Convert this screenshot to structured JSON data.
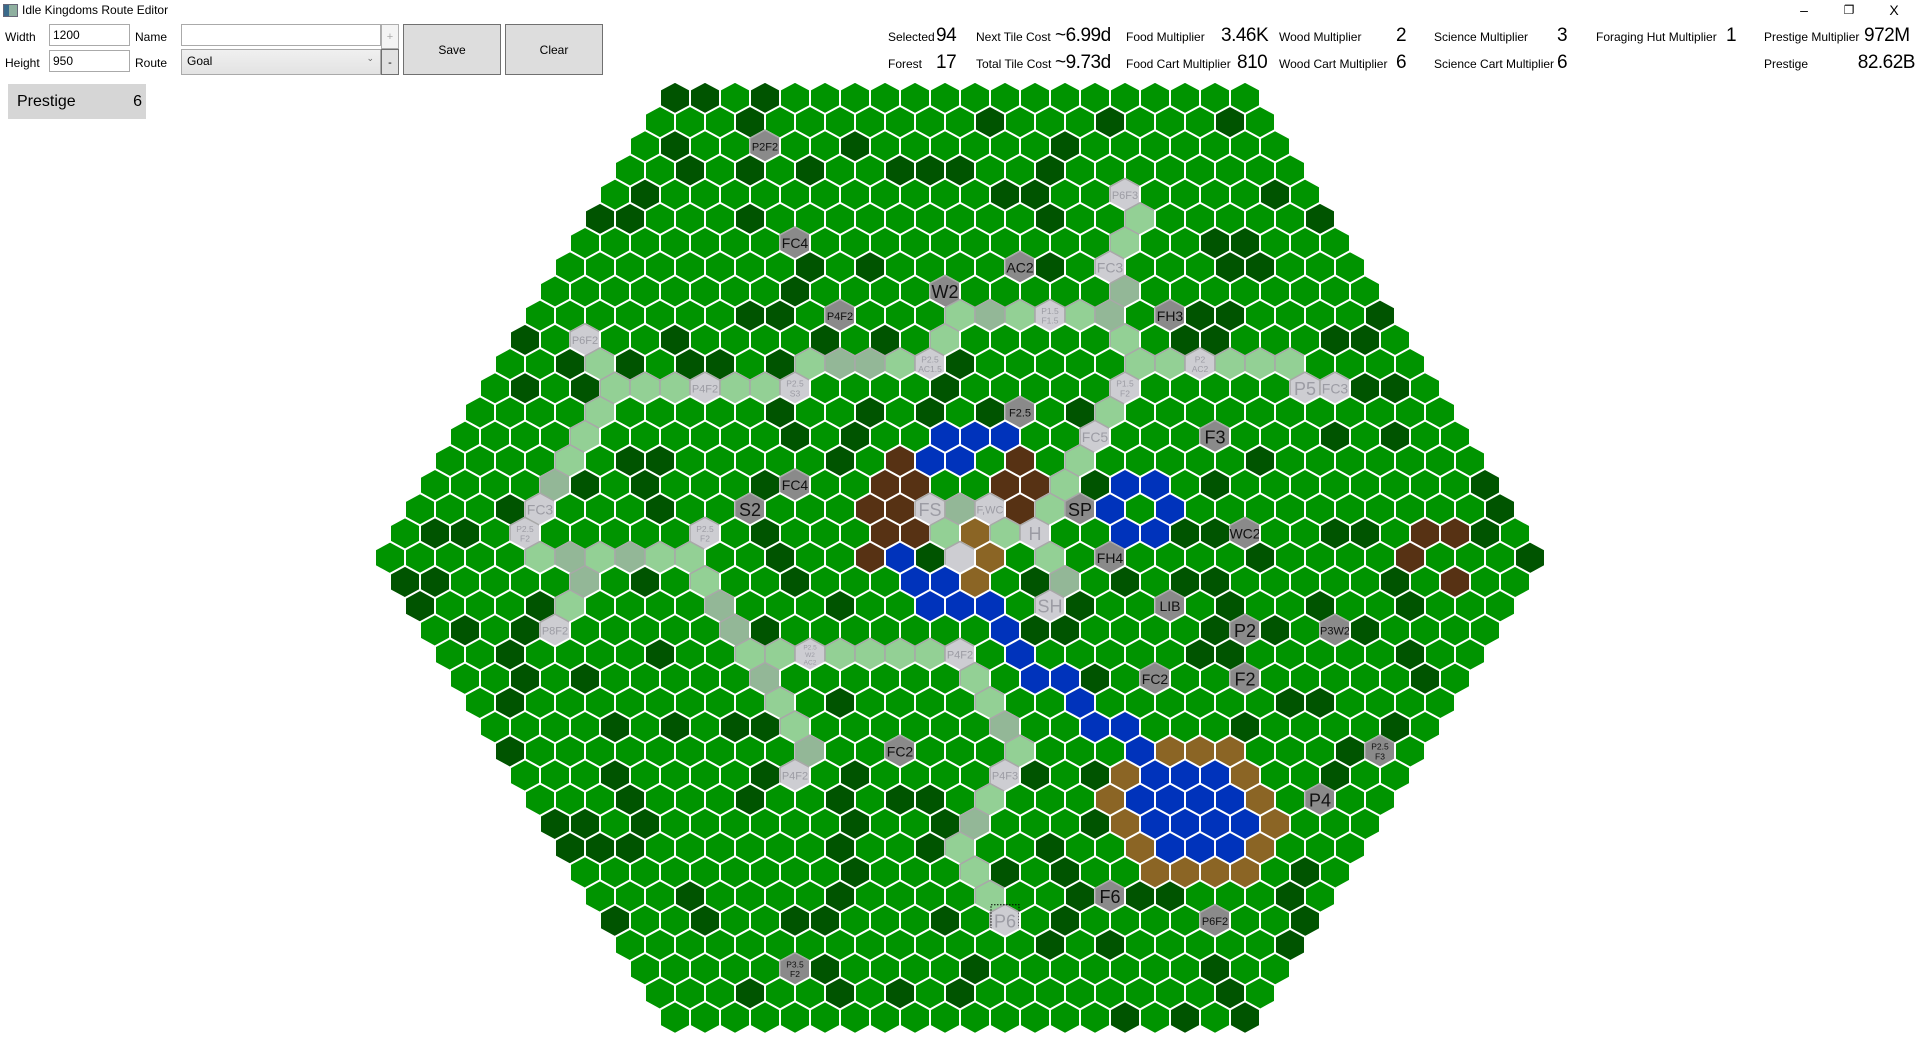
{
  "window": {
    "title": "Idle Kingdoms Route Editor",
    "minimize": "–",
    "restore": "❐",
    "close": "X"
  },
  "toolbar": {
    "width_label": "Width",
    "width_value": "1200",
    "height_label": "Height",
    "height_value": "950",
    "name_label": "Name",
    "name_value": "",
    "add_label": "+",
    "route_label": "Route",
    "route_value": "Goal",
    "remove_label": "-",
    "save_label": "Save",
    "clear_label": "Clear"
  },
  "prestige_box": {
    "label": "Prestige",
    "value": "6"
  },
  "stats": {
    "selected": {
      "label": "Selected",
      "value": "94"
    },
    "forest": {
      "label": "Forest",
      "value": "17"
    },
    "next_tile_cost": {
      "label": "Next Tile Cost",
      "value": "~6.99d"
    },
    "total_tile_cost": {
      "label": "Total Tile Cost",
      "value": "~9.73d"
    },
    "food_multiplier": {
      "label": "Food Multiplier",
      "value": "3.46K"
    },
    "food_cart_multiplier": {
      "label": "Food Cart Multiplier",
      "value": "810"
    },
    "wood_multiplier": {
      "label": "Wood Multiplier",
      "value": "2"
    },
    "wood_cart_multiplier": {
      "label": "Wood Cart Multiplier",
      "value": "6"
    },
    "science_multiplier": {
      "label": "Science Multiplier",
      "value": "3"
    },
    "science_cart_multiplier": {
      "label": "Science Cart Multiplier",
      "value": "6"
    },
    "foraging_hut_multiplier": {
      "label": "Foraging Hut Multiplier",
      "value": "1"
    },
    "prestige_multiplier": {
      "label": "Prestige Multiplier",
      "value": "972M"
    },
    "prestige": {
      "label": "Prestige",
      "value": "82.62B"
    }
  },
  "board": {
    "rows": 39,
    "min_row_length": 20,
    "selected_tile": [
      34,
      13
    ],
    "colors": {
      "grass": "#009400",
      "forest": "#005400",
      "water": "#0033bb",
      "mountain": "#573214",
      "hill": "#8b6525",
      "path": "#93d095",
      "path_alt": "#93b797",
      "owned": "#cdcdd2",
      "building": "#8a8a8a"
    },
    "tiles": [
      [
        2,
        4,
        "building",
        "P2F2"
      ],
      [
        6,
        7,
        "building",
        "FC4"
      ],
      [
        8,
        13,
        "building",
        "W2"
      ],
      [
        9,
        10,
        "building",
        "P4F2"
      ],
      [
        7,
        15,
        "building",
        "AC2"
      ],
      [
        9,
        21,
        "building",
        "FH3"
      ],
      [
        13,
        18,
        "building",
        "F2.5"
      ],
      [
        14,
        25,
        "building",
        "F3"
      ],
      [
        17,
        22,
        "building",
        "SP"
      ],
      [
        16,
        12,
        "building",
        "FC4"
      ],
      [
        17,
        11,
        "building",
        "S2"
      ],
      [
        18,
        28,
        "building",
        "WC2"
      ],
      [
        19,
        24,
        "building",
        "FH4"
      ],
      [
        21,
        25,
        "building",
        "LIB"
      ],
      [
        22,
        27,
        "building",
        "P2"
      ],
      [
        22,
        30,
        "building",
        "P3W2"
      ],
      [
        24,
        23,
        "building",
        "FC2"
      ],
      [
        24,
        26,
        "building",
        "F2"
      ],
      [
        27,
        13,
        "building",
        "FC2"
      ],
      [
        27,
        29,
        "building",
        "P2.5\nF3"
      ],
      [
        29,
        26,
        "building",
        "P4"
      ],
      [
        33,
        17,
        "building",
        "F6"
      ],
      [
        34,
        20,
        "building",
        "P6F2"
      ],
      [
        36,
        5,
        "building",
        "P3.5\nF2"
      ],
      [
        4,
        17,
        "owned",
        "P6F3"
      ],
      [
        7,
        18,
        "owned",
        "FC3"
      ],
      [
        9,
        17,
        "owned",
        "P1.5\nF1.5"
      ],
      [
        11,
        23,
        "owned",
        "P2\nAC2"
      ],
      [
        12,
        21,
        "owned",
        "P1.5\nF2"
      ],
      [
        12,
        27,
        "owned",
        "P5"
      ],
      [
        12,
        28,
        "owned",
        "FC3"
      ],
      [
        14,
        21,
        "owned",
        "FC5"
      ],
      [
        17,
        17,
        "owned",
        "FS"
      ],
      [
        17,
        19,
        "owned",
        "F,WC"
      ],
      [
        18,
        21,
        "owned",
        "H"
      ],
      [
        21,
        21,
        "owned",
        "SH"
      ],
      [
        10,
        2,
        "owned",
        "P6F2"
      ],
      [
        11,
        14,
        "owned",
        "P2.5\nAC1.5"
      ],
      [
        12,
        7,
        "owned",
        "P4F2"
      ],
      [
        12,
        10,
        "owned",
        "P2.5\nS3"
      ],
      [
        17,
        4,
        "owned",
        "FC3"
      ],
      [
        18,
        4,
        "owned",
        "P2.5\nF2"
      ],
      [
        18,
        10,
        "owned",
        "P2.5\nF2"
      ],
      [
        22,
        4,
        "owned",
        "P8F2"
      ],
      [
        23,
        12,
        "owned",
        "P2.5\nW2\nAC2"
      ],
      [
        23,
        17,
        "owned",
        "P4F2"
      ],
      [
        28,
        9,
        "owned",
        "P4F2"
      ],
      [
        28,
        16,
        "owned",
        "P4F3"
      ],
      [
        34,
        13,
        "owned",
        "P6"
      ],
      [
        19,
        19,
        "owned",
        ""
      ],
      [
        5,
        18,
        "path"
      ],
      [
        6,
        18,
        "path"
      ],
      [
        9,
        14,
        "path"
      ],
      [
        9,
        16,
        "path"
      ],
      [
        9,
        18,
        "path"
      ],
      [
        10,
        14,
        "path"
      ],
      [
        10,
        20,
        "path"
      ],
      [
        11,
        3,
        "path"
      ],
      [
        11,
        10,
        "path"
      ],
      [
        11,
        13,
        "path"
      ],
      [
        11,
        21,
        "path"
      ],
      [
        11,
        22,
        "path"
      ],
      [
        11,
        24,
        "path"
      ],
      [
        11,
        25,
        "path"
      ],
      [
        11,
        26,
        "path"
      ],
      [
        12,
        4,
        "path"
      ],
      [
        12,
        5,
        "path"
      ],
      [
        12,
        6,
        "path"
      ],
      [
        12,
        8,
        "path"
      ],
      [
        12,
        9,
        "path"
      ],
      [
        13,
        4,
        "path"
      ],
      [
        14,
        4,
        "path"
      ],
      [
        15,
        4,
        "path"
      ],
      [
        13,
        21,
        "path"
      ],
      [
        15,
        21,
        "path"
      ],
      [
        16,
        21,
        "path"
      ],
      [
        17,
        21,
        "path"
      ],
      [
        18,
        18,
        "path"
      ],
      [
        18,
        20,
        "path"
      ],
      [
        19,
        22,
        "path"
      ],
      [
        19,
        5,
        "path"
      ],
      [
        19,
        7,
        "path"
      ],
      [
        19,
        9,
        "path"
      ],
      [
        19,
        10,
        "path"
      ],
      [
        21,
        5,
        "path"
      ],
      [
        23,
        10,
        "path"
      ],
      [
        23,
        11,
        "path"
      ],
      [
        23,
        13,
        "path"
      ],
      [
        23,
        14,
        "path"
      ],
      [
        23,
        15,
        "path"
      ],
      [
        23,
        16,
        "path"
      ],
      [
        25,
        10,
        "path"
      ],
      [
        26,
        10,
        "path"
      ],
      [
        24,
        17,
        "path"
      ],
      [
        25,
        17,
        "path"
      ],
      [
        27,
        17,
        "path"
      ],
      [
        29,
        15,
        "path"
      ],
      [
        31,
        13,
        "path"
      ],
      [
        32,
        13,
        "path"
      ],
      [
        33,
        13,
        "path"
      ],
      [
        8,
        19,
        "path_alt"
      ],
      [
        9,
        15,
        "path_alt"
      ],
      [
        9,
        19,
        "path_alt"
      ],
      [
        11,
        11,
        "path_alt"
      ],
      [
        11,
        12,
        "path_alt"
      ],
      [
        16,
        4,
        "path_alt"
      ],
      [
        17,
        18,
        "path_alt"
      ],
      [
        19,
        6,
        "path_alt"
      ],
      [
        19,
        8,
        "path_alt"
      ],
      [
        20,
        6,
        "path_alt"
      ],
      [
        20,
        22,
        "path_alt"
      ],
      [
        21,
        10,
        "path_alt"
      ],
      [
        22,
        10,
        "path_alt"
      ],
      [
        20,
        10,
        "path"
      ],
      [
        24,
        10,
        "path_alt"
      ],
      [
        27,
        10,
        "path_alt"
      ],
      [
        26,
        17,
        "path_alt"
      ],
      [
        30,
        14,
        "path_alt"
      ],
      [
        14,
        16,
        "water"
      ],
      [
        14,
        17,
        "water"
      ],
      [
        14,
        18,
        "water"
      ],
      [
        15,
        16,
        "water"
      ],
      [
        15,
        17,
        "water"
      ],
      [
        16,
        23,
        "water"
      ],
      [
        16,
        24,
        "water"
      ],
      [
        17,
        23,
        "water"
      ],
      [
        17,
        25,
        "water"
      ],
      [
        18,
        24,
        "water"
      ],
      [
        18,
        25,
        "water"
      ],
      [
        19,
        17,
        "water"
      ],
      [
        20,
        17,
        "water"
      ],
      [
        20,
        18,
        "water"
      ],
      [
        21,
        17,
        "water"
      ],
      [
        21,
        18,
        "water"
      ],
      [
        21,
        19,
        "water"
      ],
      [
        22,
        19,
        "water"
      ],
      [
        23,
        19,
        "water"
      ],
      [
        24,
        19,
        "water"
      ],
      [
        24,
        20,
        "water"
      ],
      [
        25,
        20,
        "water"
      ],
      [
        26,
        20,
        "water"
      ],
      [
        26,
        21,
        "water"
      ],
      [
        27,
        21,
        "water"
      ],
      [
        28,
        21,
        "water"
      ],
      [
        28,
        22,
        "water"
      ],
      [
        28,
        23,
        "water"
      ],
      [
        29,
        20,
        "water"
      ],
      [
        29,
        21,
        "water"
      ],
      [
        29,
        22,
        "water"
      ],
      [
        29,
        23,
        "water"
      ],
      [
        30,
        20,
        "water"
      ],
      [
        30,
        21,
        "water"
      ],
      [
        30,
        22,
        "water"
      ],
      [
        30,
        23,
        "water"
      ],
      [
        31,
        20,
        "water"
      ],
      [
        31,
        21,
        "water"
      ],
      [
        31,
        22,
        "water"
      ],
      [
        15,
        15,
        "mountain"
      ],
      [
        15,
        19,
        "mountain"
      ],
      [
        16,
        15,
        "mountain"
      ],
      [
        16,
        16,
        "mountain"
      ],
      [
        16,
        19,
        "mountain"
      ],
      [
        16,
        20,
        "mountain"
      ],
      [
        17,
        15,
        "mountain"
      ],
      [
        17,
        16,
        "mountain"
      ],
      [
        17,
        20,
        "mountain"
      ],
      [
        18,
        16,
        "mountain"
      ],
      [
        18,
        17,
        "mountain"
      ],
      [
        19,
        16,
        "mountain"
      ],
      [
        18,
        34,
        "mountain"
      ],
      [
        18,
        35,
        "mountain"
      ],
      [
        19,
        34,
        "mountain"
      ],
      [
        20,
        35,
        "mountain"
      ],
      [
        18,
        19,
        "hill"
      ],
      [
        19,
        20,
        "hill"
      ],
      [
        20,
        19,
        "hill"
      ],
      [
        27,
        22,
        "hill"
      ],
      [
        27,
        23,
        "hill"
      ],
      [
        27,
        24,
        "hill"
      ],
      [
        28,
        20,
        "hill"
      ],
      [
        28,
        24,
        "hill"
      ],
      [
        29,
        19,
        "hill"
      ],
      [
        29,
        24,
        "hill"
      ],
      [
        30,
        19,
        "hill"
      ],
      [
        30,
        24,
        "hill"
      ],
      [
        31,
        19,
        "hill"
      ],
      [
        31,
        23,
        "hill"
      ],
      [
        32,
        19,
        "hill"
      ],
      [
        32,
        20,
        "hill"
      ],
      [
        32,
        21,
        "hill"
      ],
      [
        32,
        22,
        "hill"
      ]
    ]
  }
}
